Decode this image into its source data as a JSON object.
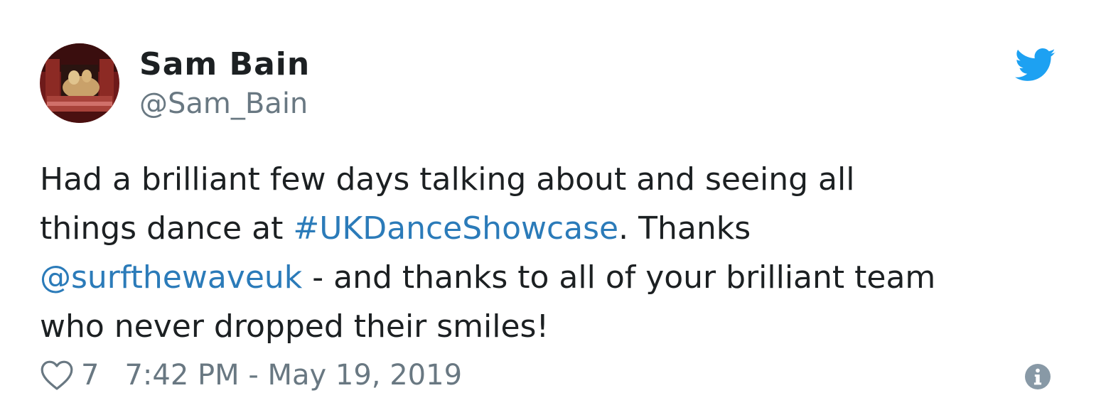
{
  "author": {
    "name": "Sam Bain",
    "handle": "@Sam_Bain"
  },
  "tweet": {
    "lines": [
      [
        {
          "text": "Had a brilliant few days talking about and seeing all",
          "type": "text"
        }
      ],
      [
        {
          "text": "things dance at ",
          "type": "text"
        },
        {
          "text": "#UKDanceShowcase",
          "type": "hashtag"
        },
        {
          "text": ". Thanks",
          "type": "text"
        }
      ],
      [
        {
          "text": "@surfthewaveuk",
          "type": "mention"
        },
        {
          "text": " - and thanks to all of your brilliant team",
          "type": "text"
        }
      ],
      [
        {
          "text": "who never dropped their smiles!",
          "type": "text"
        }
      ]
    ]
  },
  "footer": {
    "like_count": "7",
    "timestamp": "7:42 PM - May 19, 2019"
  },
  "icons": {
    "brand": "twitter-bird-icon",
    "like": "heart-icon",
    "info": "info-icon"
  },
  "colors": {
    "link": "#2b7bb9",
    "brand": "#1da1f2",
    "text": "#1c2022",
    "muted": "#697882"
  }
}
